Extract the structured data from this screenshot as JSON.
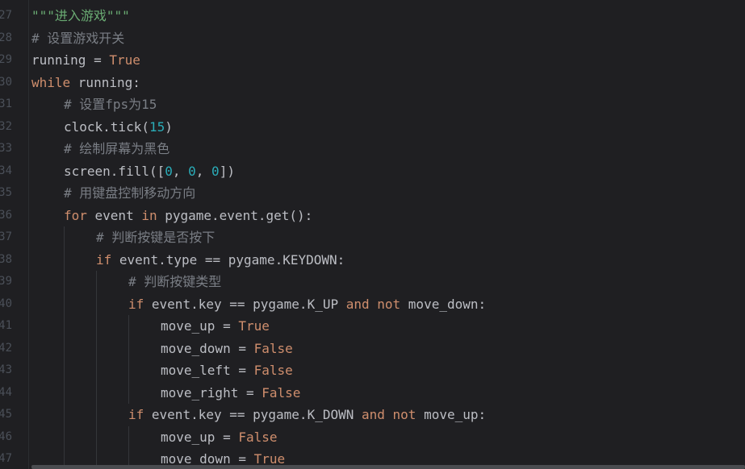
{
  "editor": {
    "line_numbers": [
      "27",
      "28",
      "29",
      "30",
      "31",
      "32",
      "33",
      "34",
      "35",
      "36",
      "37",
      "38",
      "39",
      "40",
      "41",
      "42",
      "43",
      "44",
      "45",
      "46",
      "47"
    ],
    "lines": [
      {
        "indent": 0,
        "tokens": [
          {
            "t": "\"\"\"进入游戏\"\"\"",
            "k": "str"
          }
        ]
      },
      {
        "indent": 0,
        "tokens": [
          {
            "t": "# 设置游戏开关",
            "k": "com"
          }
        ]
      },
      {
        "indent": 0,
        "tokens": [
          {
            "t": "running = ",
            "k": "txt"
          },
          {
            "t": "True",
            "k": "kw"
          }
        ]
      },
      {
        "indent": 0,
        "tokens": [
          {
            "t": "while ",
            "k": "kw"
          },
          {
            "t": "running:",
            "k": "txt"
          }
        ]
      },
      {
        "indent": 1,
        "tokens": [
          {
            "t": "# 设置fps为15",
            "k": "com"
          }
        ]
      },
      {
        "indent": 1,
        "tokens": [
          {
            "t": "clock.tick(",
            "k": "txt"
          },
          {
            "t": "15",
            "k": "num"
          },
          {
            "t": ")",
            "k": "txt"
          }
        ]
      },
      {
        "indent": 1,
        "tokens": [
          {
            "t": "# 绘制屏幕为黑色",
            "k": "com"
          }
        ]
      },
      {
        "indent": 1,
        "tokens": [
          {
            "t": "screen.fill([",
            "k": "txt"
          },
          {
            "t": "0",
            "k": "num"
          },
          {
            "t": ", ",
            "k": "txt"
          },
          {
            "t": "0",
            "k": "num"
          },
          {
            "t": ", ",
            "k": "txt"
          },
          {
            "t": "0",
            "k": "num"
          },
          {
            "t": "])",
            "k": "txt"
          }
        ]
      },
      {
        "indent": 1,
        "tokens": [
          {
            "t": "# 用键盘控制移动方向",
            "k": "com"
          }
        ]
      },
      {
        "indent": 1,
        "tokens": [
          {
            "t": "for ",
            "k": "kw"
          },
          {
            "t": "event ",
            "k": "txt"
          },
          {
            "t": "in ",
            "k": "kw"
          },
          {
            "t": "pygame.event.get():",
            "k": "txt"
          }
        ]
      },
      {
        "indent": 2,
        "tokens": [
          {
            "t": "# 判断按键是否按下",
            "k": "com"
          }
        ]
      },
      {
        "indent": 2,
        "tokens": [
          {
            "t": "if ",
            "k": "kw"
          },
          {
            "t": "event.type == pygame.KEYDOWN:",
            "k": "txt"
          }
        ]
      },
      {
        "indent": 3,
        "tokens": [
          {
            "t": "# 判断按键类型",
            "k": "com"
          }
        ]
      },
      {
        "indent": 3,
        "tokens": [
          {
            "t": "if ",
            "k": "kw"
          },
          {
            "t": "event.key == pygame.K_UP ",
            "k": "txt"
          },
          {
            "t": "and not ",
            "k": "kw"
          },
          {
            "t": "move_down:",
            "k": "txt"
          }
        ]
      },
      {
        "indent": 4,
        "tokens": [
          {
            "t": "move_up = ",
            "k": "txt"
          },
          {
            "t": "True",
            "k": "kw"
          }
        ]
      },
      {
        "indent": 4,
        "tokens": [
          {
            "t": "move_down = ",
            "k": "txt"
          },
          {
            "t": "False",
            "k": "kw"
          }
        ]
      },
      {
        "indent": 4,
        "tokens": [
          {
            "t": "move_left = ",
            "k": "txt"
          },
          {
            "t": "False",
            "k": "kw"
          }
        ]
      },
      {
        "indent": 4,
        "tokens": [
          {
            "t": "move_right = ",
            "k": "txt"
          },
          {
            "t": "False",
            "k": "kw"
          }
        ]
      },
      {
        "indent": 3,
        "tokens": [
          {
            "t": "if ",
            "k": "kw"
          },
          {
            "t": "event.key == pygame.K_DOWN ",
            "k": "txt"
          },
          {
            "t": "and not ",
            "k": "kw"
          },
          {
            "t": "move_up:",
            "k": "txt"
          }
        ]
      },
      {
        "indent": 4,
        "tokens": [
          {
            "t": "move_up = ",
            "k": "txt"
          },
          {
            "t": "False",
            "k": "kw"
          }
        ]
      },
      {
        "indent": 4,
        "tokens": [
          {
            "t": "move_down = ",
            "k": "txt"
          },
          {
            "t": "True",
            "k": "kw"
          }
        ]
      }
    ]
  },
  "colors": {
    "background": "#1f1f22",
    "string": "#6aab73",
    "comment": "#7a7e85",
    "keyword": "#cf8e6d",
    "number": "#2aacb8",
    "text": "#bcbec4",
    "line_number": "#4b5059"
  }
}
